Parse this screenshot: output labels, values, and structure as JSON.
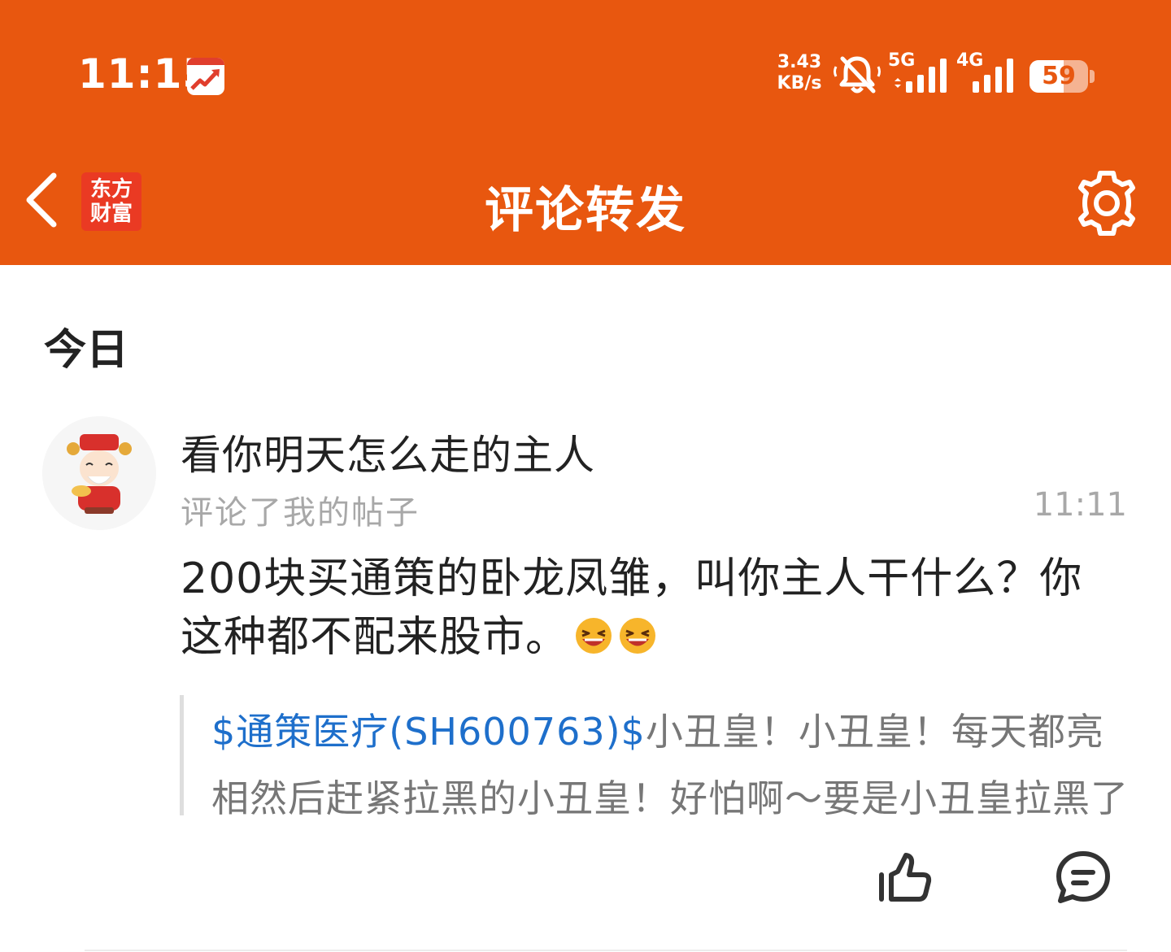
{
  "status_bar": {
    "time": "11:15",
    "net_speed_value": "3.43",
    "net_speed_unit": "KB/s",
    "sim1": "5G",
    "sim2": "4G",
    "battery": "59"
  },
  "nav": {
    "logo_line1": "东方",
    "logo_line2": "财富",
    "title": "评论转发"
  },
  "section_date": "今日",
  "notification": {
    "username": "看你明天怎么走的主人",
    "action": "评论了我的帖子",
    "time": "11:11",
    "comment": "200块买通策的卧龙凤雏，叫你主人干什么？你这种都不配来股市。",
    "quote_stock": "$通策医疗(SH600763)$",
    "quote_text": "小丑皇！小丑皇！每天都亮相然后赶紧拉黑的小丑皇！好怕啊～要是小丑皇拉黑了"
  },
  "colors": {
    "brand_orange": "#E8570F",
    "logo_red": "#EA3A23",
    "link_blue": "#1E6FCB"
  },
  "icons": [
    "back-arrow-icon",
    "settings-gear-icon",
    "mute-bell-icon",
    "signal-icon",
    "battery-icon",
    "thumbs-up-icon",
    "comment-bubble-icon",
    "laughing-emoji-icon"
  ]
}
